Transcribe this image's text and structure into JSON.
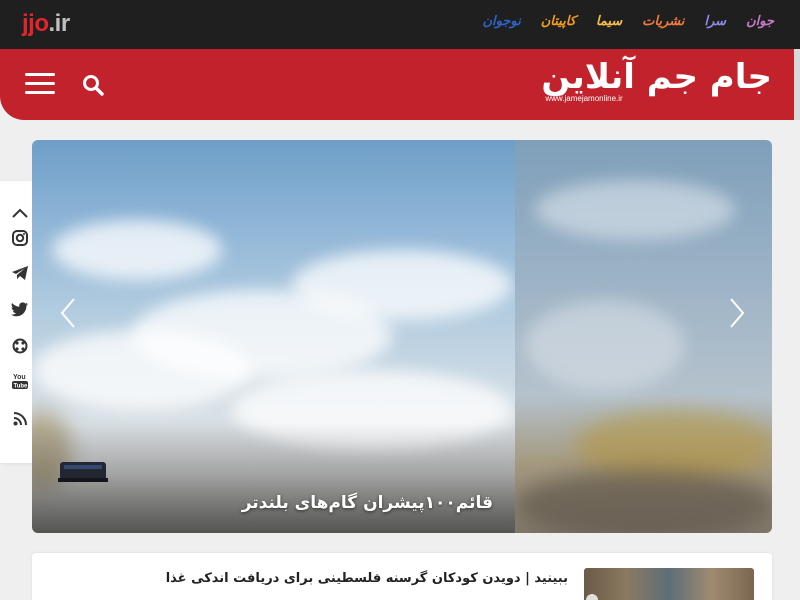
{
  "top_bar": {
    "jjo_logo": {
      "main": "jjo",
      "dot": ".",
      "tld": "ir"
    },
    "sister_sites": [
      {
        "label": "جوان",
        "color": "#c879c9"
      },
      {
        "label": "سرا",
        "color": "#8d88e6"
      },
      {
        "label": "نشریات",
        "color": "#ee7b3f"
      },
      {
        "label": "سیما",
        "color": "#f5c04a"
      },
      {
        "label": "کاپیتان",
        "color": "#f29f1f"
      },
      {
        "label": "نوجوان",
        "color": "#2d63c8"
      }
    ]
  },
  "header": {
    "logo_text": "جام جم آنلاین",
    "logo_url": "www.jamejamonline.ir",
    "menu_icon": "hamburger-icon",
    "search_icon": "search-icon",
    "color": "#c1222b"
  },
  "social": {
    "items": [
      "chevron-up-icon",
      "instagram-icon",
      "telegram-icon",
      "twitter-icon",
      "aparat-icon",
      "youtube-icon",
      "rss-icon"
    ]
  },
  "slider": {
    "caption": "قائم۱۰۰پیشران گام‌های بلندتر",
    "prev_icon": "chevron-left-icon",
    "next_icon": "chevron-right-icon"
  },
  "news": {
    "title": "ببینید | دویدن کودکان گرسنه فلسطینی برای دریافت اندکی غذا"
  }
}
